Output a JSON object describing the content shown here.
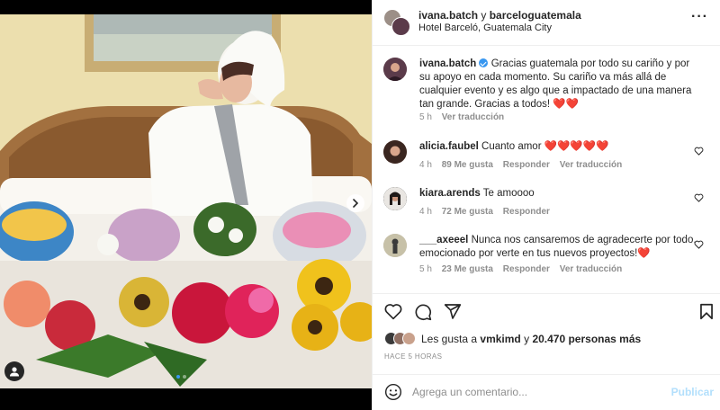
{
  "post": {
    "author": "ivana.batch",
    "connector": "y",
    "collaborator": "barceloguatemala",
    "location": "Hotel Barceló, Guatemala City",
    "more_icon": "more-horizontal-icon"
  },
  "caption": {
    "username": "ivana.batch",
    "text": "Gracias guatemala por todo su cariño y por su apoyo en cada momento. Su cariño va más allá de cualquier evento y es algo que a impactado de una manera tan grande. Gracias a todos! ❤️❤️",
    "time": "5 h",
    "translate": "Ver traducción"
  },
  "comments": [
    {
      "username": "alicia.faubel",
      "text": "Cuanto amor ❤️❤️❤️❤️❤️",
      "time": "4 h",
      "likes": "89 Me gusta",
      "reply": "Responder",
      "translate": "Ver traducción"
    },
    {
      "username": "kiara.arends",
      "text": "Te amoooo",
      "time": "4 h",
      "likes": "72 Me gusta",
      "reply": "Responder"
    },
    {
      "username": "___axeeel",
      "text": "Nunca nos cansaremos de agradecerte por todo, emocionado por verte en tus nuevos proyectos!❤️",
      "time": "5 h",
      "likes": "23 Me gusta",
      "reply": "Responder",
      "translate": "Ver traducción"
    }
  ],
  "likes_line": {
    "prefix": "Les gusta a",
    "user": "vmkimd",
    "and": "y",
    "others": "20.470 personas más"
  },
  "timestamp": "HACE 5 HORAS",
  "composer": {
    "placeholder": "Agrega un comentario...",
    "post_label": "Publicar"
  },
  "photo": {
    "slides_total": 2,
    "slide_active": 1
  },
  "colors": {
    "link_blue": "#3897f0",
    "post_disabled": "#b2dffc",
    "muted": "#8e8e8e",
    "text": "#262626"
  }
}
